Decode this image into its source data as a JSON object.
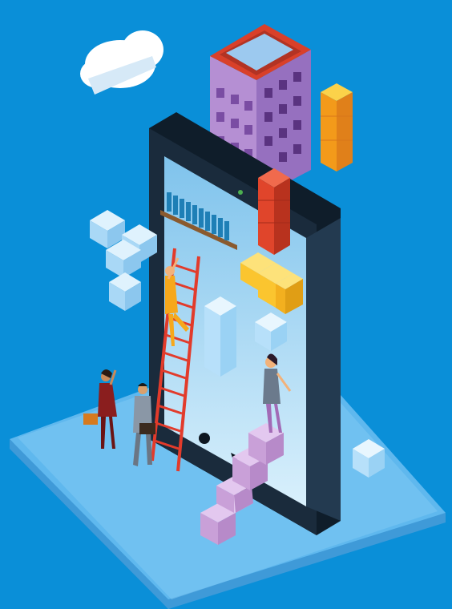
{
  "scene": {
    "type": "isometric-illustration",
    "background_color": "#0a8fd8",
    "palette": {
      "platform_top": "#5fb8ee",
      "platform_side": "#2a7fc6",
      "tablet_frame": "#1a2b3c",
      "tablet_screen": "#9fd6f5",
      "cube_light_blue": "#b7e0fa",
      "cube_yellow": "#fbc52f",
      "cube_orange": "#f39a1a",
      "cube_red": "#e0452b",
      "cube_purple": "#c9a0d8",
      "building": "#b58fd3",
      "roof": "#d9402a",
      "solar_panel": "#9cc9ef",
      "ladder": "#e23b2b"
    },
    "elements": [
      "cloud-icon",
      "apartment-building",
      "tablet-device",
      "bookshelf",
      "red-ladder",
      "purple-stairs",
      "yellow-tetromino",
      "orange-tetromino",
      "red-tetromino",
      "light-blue-blocks",
      "businesswoman-with-bag",
      "businessman-with-briefcase",
      "woman-climbing-ladder",
      "woman-on-stairs"
    ]
  }
}
